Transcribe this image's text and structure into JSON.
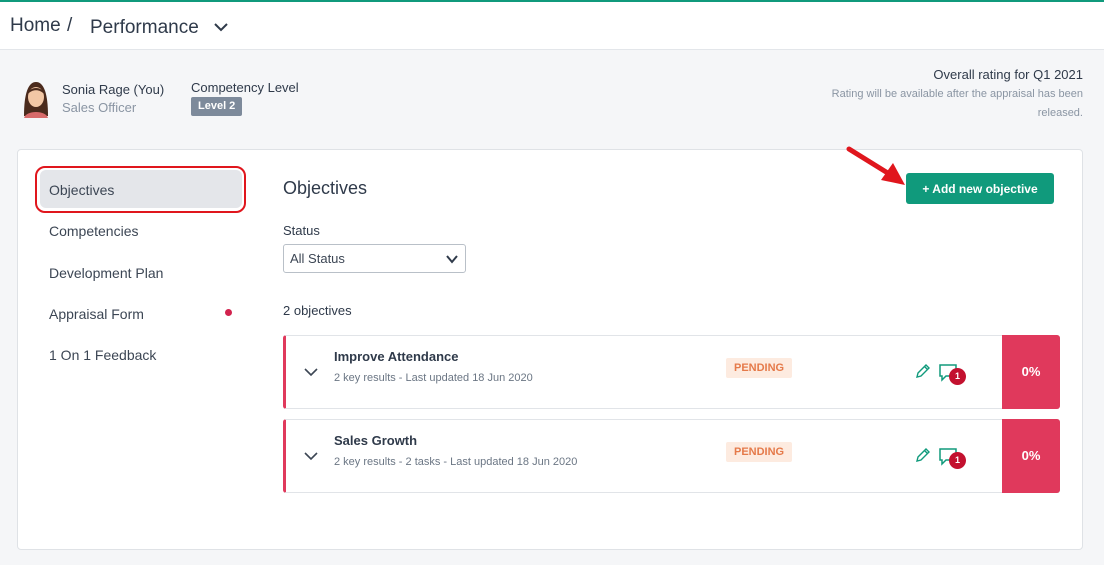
{
  "breadcrumb": {
    "home": "Home",
    "separator": "/",
    "current": "Performance"
  },
  "profile": {
    "name": "Sonia Rage (You)",
    "role": "Sales Officer",
    "competency_title": "Competency Level",
    "competency_level": "Level 2"
  },
  "rating": {
    "title": "Overall rating for Q1 2021",
    "note": "Rating will be available after the appraisal has been released."
  },
  "sidebar": {
    "items": [
      {
        "label": "Objectives",
        "active": true
      },
      {
        "label": "Competencies"
      },
      {
        "label": "Development Plan"
      },
      {
        "label": "Appraisal Form",
        "has_dot": true
      },
      {
        "label": "1 On 1 Feedback"
      }
    ]
  },
  "main": {
    "title": "Objectives",
    "add_button": "+ Add new objective",
    "status_label": "Status",
    "status_value": "All Status",
    "count": "2 objectives",
    "objectives": [
      {
        "title": "Improve Attendance",
        "meta": "2 key results - Last updated 18 Jun 2020",
        "status": "PENDING",
        "comments": "1",
        "progress": "0%"
      },
      {
        "title": "Sales Growth",
        "meta": "2 key results - 2 tasks - Last updated 18 Jun 2020",
        "status": "PENDING",
        "comments": "1",
        "progress": "0%"
      }
    ]
  },
  "colors": {
    "accent": "#109a7c",
    "progress": "#e0395c",
    "pending_bg": "#fdebe0",
    "pending_text": "#e57a4a",
    "annotation": "#e0161d"
  }
}
